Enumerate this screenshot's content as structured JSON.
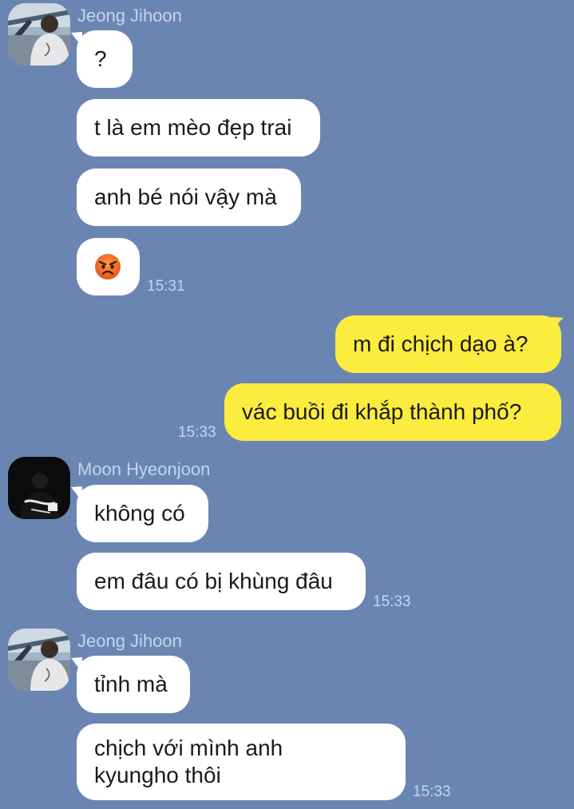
{
  "chat": {
    "groups": [
      {
        "sender": "Jeong Jihoon",
        "avatar_icon": "profile-photo-jeong-jihoon",
        "messages": [
          "?",
          "t là em mèo đẹp trai",
          "anh bé nói vậy mà"
        ],
        "emoji_message_icon": "angry-face-emoji",
        "time": "15:31"
      },
      {
        "sender": "me",
        "messages": [
          "m đi chịch dạo à?",
          "vác buồi đi khắp thành phố?"
        ],
        "time": "15:33"
      },
      {
        "sender": "Moon Hyeonjoon",
        "avatar_icon": "profile-photo-moon-hyeonjoon",
        "messages": [
          "không có",
          "em đâu có bị khùng đâu"
        ],
        "time": "15:33"
      },
      {
        "sender": "Jeong Jihoon",
        "avatar_icon": "profile-photo-jeong-jihoon",
        "messages": [
          "tỉnh mà",
          "chịch với mình anh kyungho thôi"
        ],
        "time": "15:33"
      }
    ]
  },
  "colors": {
    "background": "#6b85b3",
    "incoming_bubble": "#ffffff",
    "outgoing_bubble": "#fcec3d",
    "meta_text": "#c7d4ec"
  }
}
